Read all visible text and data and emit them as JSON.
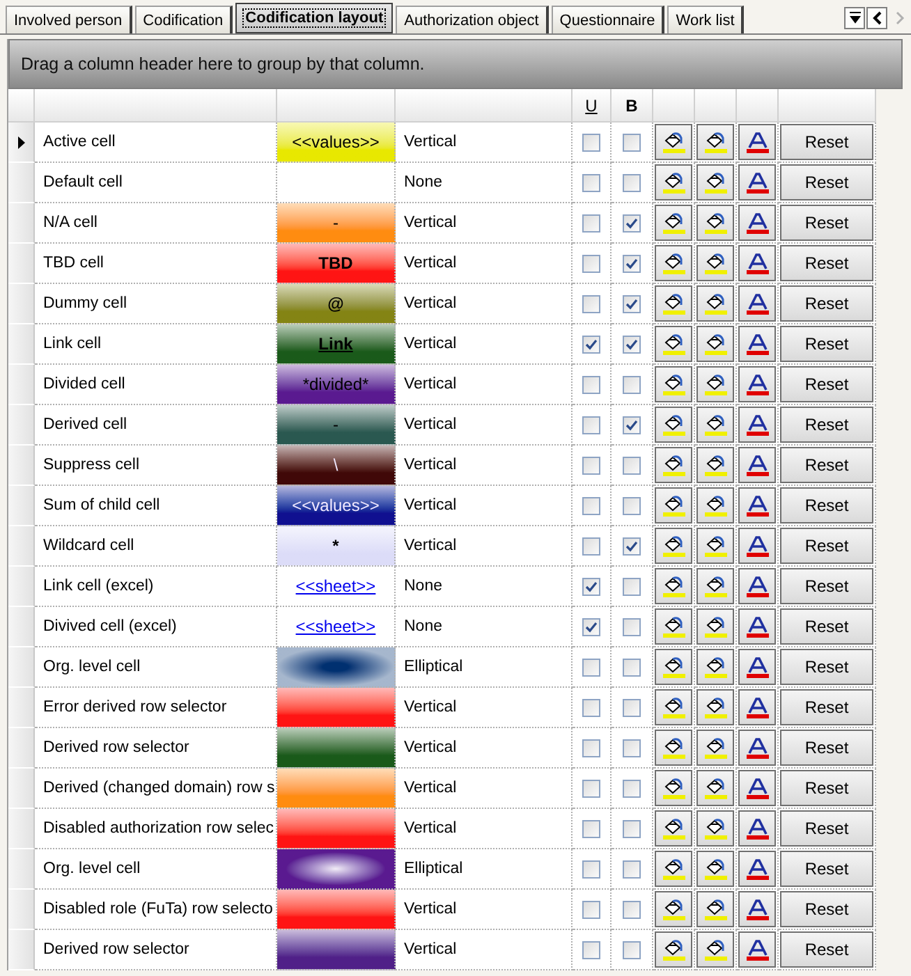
{
  "tabs": [
    {
      "label": "Involved person",
      "selected": false
    },
    {
      "label": "Codification",
      "selected": false
    },
    {
      "label": "Codification layout",
      "selected": true
    },
    {
      "label": "Authorization object",
      "selected": false
    },
    {
      "label": "Questionnaire",
      "selected": false
    },
    {
      "label": "Work list",
      "selected": false
    }
  ],
  "group_panel": {
    "hint": "Drag a column header here to group by that column."
  },
  "table": {
    "columns": [
      {
        "label": "U",
        "kind": "underline"
      },
      {
        "label": "B",
        "kind": "bold"
      }
    ],
    "rows": [
      {
        "name": "Active cell",
        "current": true,
        "preview": {
          "text": "<<values>>",
          "kind": "vertical",
          "color": "#e8e800"
        },
        "gradient": "Vertical",
        "u": false,
        "b": false,
        "reset": "Reset"
      },
      {
        "name": "Default cell",
        "current": false,
        "preview": {
          "kind": "blank"
        },
        "gradient": "None",
        "u": false,
        "b": false,
        "reset": "Reset"
      },
      {
        "name": "N/A cell",
        "current": false,
        "preview": {
          "text": "-",
          "kind": "vertical",
          "color": "#ff8c10"
        },
        "gradient": "Vertical",
        "u": false,
        "b": true,
        "reset": "Reset"
      },
      {
        "name": "TBD cell",
        "current": false,
        "preview": {
          "text": "TBD",
          "kind": "vertical-bold",
          "color": "#ff1414"
        },
        "gradient": "Vertical",
        "u": false,
        "b": true,
        "reset": "Reset"
      },
      {
        "name": "Dummy cell",
        "current": false,
        "preview": {
          "text": "@",
          "kind": "vertical-bold",
          "color": "#848414"
        },
        "gradient": "Vertical",
        "u": false,
        "b": true,
        "reset": "Reset"
      },
      {
        "name": "Link cell",
        "current": false,
        "preview": {
          "text": "Link",
          "kind": "vertical-underline",
          "color": "#1a5a1a"
        },
        "gradient": "Vertical",
        "u": true,
        "b": true,
        "reset": "Reset"
      },
      {
        "name": "Divided cell",
        "current": false,
        "preview": {
          "text": "*divided*",
          "kind": "vertical",
          "color": "#5a1a90"
        },
        "gradient": "Vertical",
        "u": false,
        "b": false,
        "reset": "Reset"
      },
      {
        "name": "Derived cell",
        "current": false,
        "preview": {
          "text": "-",
          "kind": "vertical",
          "color": "#2a5850"
        },
        "gradient": "Vertical",
        "u": false,
        "b": true,
        "reset": "Reset"
      },
      {
        "name": "Suppress cell",
        "current": false,
        "preview": {
          "text": "\\",
          "kind": "vertical-light",
          "color": "#400808"
        },
        "gradient": "Vertical",
        "u": false,
        "b": false,
        "reset": "Reset"
      },
      {
        "name": "Sum of child cell",
        "current": false,
        "preview": {
          "text": "<<values>>",
          "kind": "vertical-light",
          "color": "#101090"
        },
        "gradient": "Vertical",
        "u": false,
        "b": false,
        "reset": "Reset"
      },
      {
        "name": "Wildcard cell",
        "current": false,
        "preview": {
          "text": "*",
          "kind": "vertical-bold",
          "color": "#dcdcf8"
        },
        "gradient": "Vertical",
        "u": false,
        "b": true,
        "reset": "Reset"
      },
      {
        "name": "Link cell (excel)",
        "current": false,
        "preview": {
          "text": "<<sheet>>",
          "kind": "link"
        },
        "gradient": "None",
        "u": true,
        "b": false,
        "reset": "Reset"
      },
      {
        "name": "Divived cell (excel)",
        "current": false,
        "preview": {
          "text": "<<sheet>>",
          "kind": "link"
        },
        "gradient": "None",
        "u": true,
        "b": false,
        "reset": "Reset"
      },
      {
        "name": "Org. level cell",
        "current": false,
        "preview": {
          "kind": "elliptical-dark",
          "color": "#003070"
        },
        "gradient": "Elliptical",
        "u": false,
        "b": false,
        "reset": "Reset"
      },
      {
        "name": "Error derived row selector",
        "current": false,
        "preview": {
          "kind": "vertical",
          "color": "#ff1414"
        },
        "gradient": "Vertical",
        "u": false,
        "b": false,
        "reset": "Reset"
      },
      {
        "name": "Derived row selector",
        "current": false,
        "preview": {
          "kind": "vertical",
          "color": "#1a5a1a"
        },
        "gradient": "Vertical",
        "u": false,
        "b": false,
        "reset": "Reset"
      },
      {
        "name": "Derived (changed domain) row s",
        "current": false,
        "preview": {
          "kind": "vertical",
          "color": "#ff8c10"
        },
        "gradient": "Vertical",
        "u": false,
        "b": false,
        "reset": "Reset"
      },
      {
        "name": "Disabled authorization row selec",
        "current": false,
        "preview": {
          "kind": "vertical",
          "color": "#ff1414"
        },
        "gradient": "Vertical",
        "u": false,
        "b": false,
        "reset": "Reset"
      },
      {
        "name": "Org. level cell",
        "current": false,
        "preview": {
          "kind": "elliptical-light",
          "color": "#5a1a90"
        },
        "gradient": "Elliptical",
        "u": false,
        "b": false,
        "reset": "Reset"
      },
      {
        "name": "Disabled role (FuTa) row selecto",
        "current": false,
        "preview": {
          "kind": "vertical",
          "color": "#ff1414"
        },
        "gradient": "Vertical",
        "u": false,
        "b": false,
        "reset": "Reset"
      },
      {
        "name": "Derived row selector",
        "current": false,
        "preview": {
          "kind": "vertical",
          "color": "#502088"
        },
        "gradient": "Vertical",
        "u": false,
        "b": false,
        "reset": "Reset"
      }
    ]
  }
}
